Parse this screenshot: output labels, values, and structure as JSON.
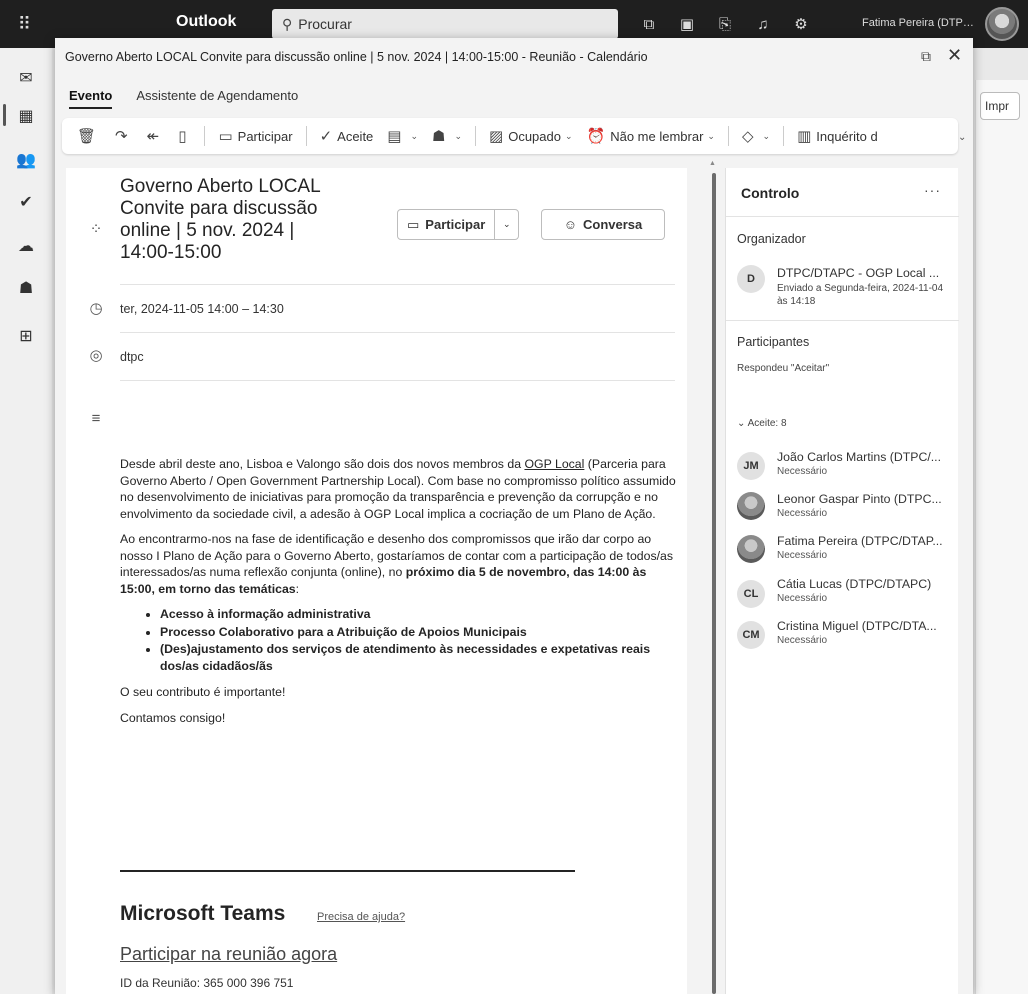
{
  "app": {
    "name": "Outlook",
    "search_placeholder": "Procurar",
    "user_name": "Fatima Pereira (DTPC/DTAPC)"
  },
  "background": {
    "peek_button": "Impr"
  },
  "window": {
    "title": "Governo Aberto LOCAL Convite para discussão online | 5 nov. 2024 | 14:00-15:00 - Reunião - Calendário",
    "tabs": [
      "Evento",
      "Assistente de Agendamento"
    ],
    "active_tab": "Evento"
  },
  "toolbar": {
    "join": "Participar",
    "accept": "Aceite",
    "busy": "Ocupado",
    "reminder": "Não me lembrar",
    "poll": "Inquérito d"
  },
  "event": {
    "subject": "Governo Aberto LOCAL Convite para discussão online | 5 nov. 2024 | 14:00-15:00",
    "join_button": "Participar",
    "chat_button": "Conversa",
    "datetime": "ter, 2024-11-05 14:00 – 14:30",
    "location": "dtpc"
  },
  "body": {
    "p1_before": "Desde abril deste ano, Lisboa e Valongo são dois dos novos membros da ",
    "p1_link": "OGP Local",
    "p1_after": " (Parceria para Governo Aberto / Open Government Partnership Local). Com base no compromisso político assumido no desenvolvimento de iniciativas para promoção da transparência e prevenção da corrupção e no envolvimento da sociedade civil, a adesão à OGP Local implica a cocriação de um Plano de Ação.",
    "p2_before": "Ao encontrarmo-nos na fase de identificação e desenho dos compromissos que irão dar corpo ao nosso I Plano de Ação para o Governo Aberto, gostaríamos de contar com a participação de todos/as interessados/as numa reflexão conjunta (online), no ",
    "p2_bold": "próximo dia 5 de novembro, das 14:00 às 15:00, em torno das temáticas",
    "p2_after": ":",
    "topics": [
      "Acesso à informação administrativa",
      "Processo Colaborativo para a Atribuição de Apoios Municipais",
      "(Des)ajustamento dos serviços de atendimento às necessidades e expetativas reais dos/as cidadãos/ãs"
    ],
    "p3": "O seu contributo é importante!",
    "p4": "Contamos consigo!"
  },
  "teams": {
    "title": "Microsoft Teams",
    "help": "Precisa de ajuda?",
    "join_link": "Participar na reunião agora",
    "meeting_id": "ID da Reunião: 365 000 396 751"
  },
  "tracking": {
    "title": "Controlo",
    "organizer_heading": "Organizador",
    "organizer_initial": "D",
    "organizer_name": "DTPC/DTAPC - OGP Local ...",
    "organizer_sent": "Enviado a Segunda-feira, 2024-11-04 às 14:18",
    "participants_heading": "Participantes",
    "responded": "Respondeu \"Aceitar\"",
    "accepted_group": "Aceite: 8",
    "attendees": [
      {
        "initials": "JM",
        "name": "João Carlos Martins (DTPC/...",
        "role": "Necessário",
        "photo": false
      },
      {
        "initials": "",
        "name": "Leonor Gaspar Pinto (DTPC...",
        "role": "Necessário",
        "photo": true
      },
      {
        "initials": "",
        "name": "Fatima Pereira (DTPC/DTAP...",
        "role": "Necessário",
        "photo": true
      },
      {
        "initials": "CL",
        "name": "Cátia Lucas (DTPC/DTAPC)",
        "role": "Necessário",
        "photo": false
      },
      {
        "initials": "CM",
        "name": "Cristina Miguel (DTPC/DTA...",
        "role": "Necessário",
        "photo": false
      }
    ]
  }
}
